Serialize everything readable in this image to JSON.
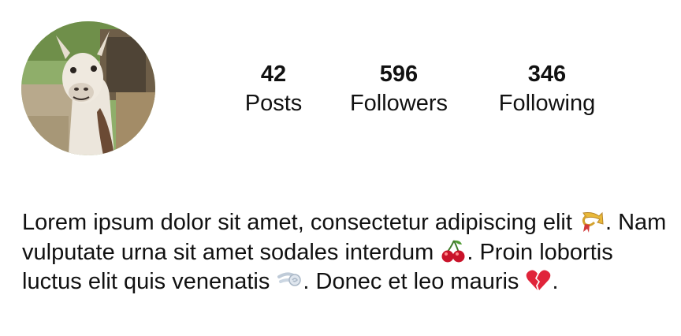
{
  "profile": {
    "avatar_icon": "llama-photo",
    "stats": [
      {
        "count": "42",
        "label": "Posts"
      },
      {
        "count": "596",
        "label": "Followers"
      },
      {
        "count": "346",
        "label": "Following"
      }
    ]
  },
  "bio": {
    "part1": "Lorem ipsum dolor sit amet, consectetur adipiscing elit ",
    "emoji1": "postal-horn-emoji",
    "part2": ". Nam vulputate urna sit amet sodales interdum ",
    "emoji2": "cherries-emoji",
    "part3": ". Proin lobortis luctus elit quis venenatis ",
    "emoji3": "dash-emoji",
    "part4": ". Donec et leo mauris ",
    "emoji4": "broken-heart-emoji",
    "part5": "."
  }
}
